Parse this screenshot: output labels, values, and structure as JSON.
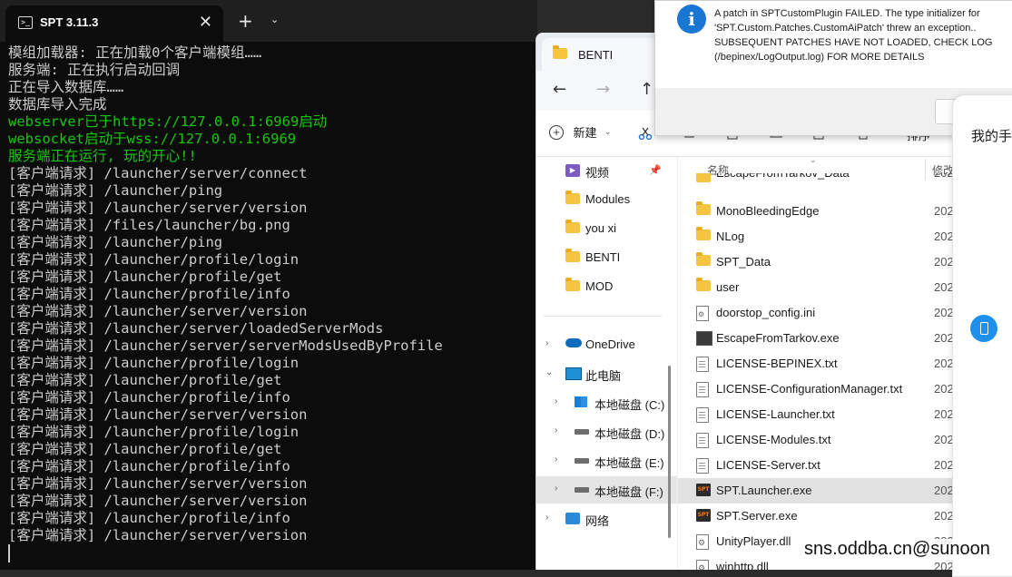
{
  "terminal": {
    "tab_title": "SPT 3.11.3",
    "tab_icon": ">_",
    "close_glyph": "✕",
    "new_tab_glyph": "+",
    "dropdown_glyph": "⌄",
    "lines": [
      {
        "text": "模组加载器: 正在加载0个客户端模组……",
        "color": "white"
      },
      {
        "text": "服务端: 正在执行启动回调",
        "color": "white"
      },
      {
        "text": "正在导入数据库……",
        "color": "white"
      },
      {
        "text": "数据库导入完成",
        "color": "white"
      },
      {
        "text": "webserver已于https://127.0.0.1:6969启动",
        "color": "green"
      },
      {
        "text": "websocket启动于wss://127.0.0.1:6969",
        "color": "green"
      },
      {
        "text": "服务端正在运行, 玩的开心!!",
        "color": "green"
      },
      {
        "text": "[客户端请求] /launcher/server/connect",
        "color": "white"
      },
      {
        "text": "[客户端请求] /launcher/ping",
        "color": "white"
      },
      {
        "text": "[客户端请求] /launcher/server/version",
        "color": "white"
      },
      {
        "text": "[客户端请求] /files/launcher/bg.png",
        "color": "white"
      },
      {
        "text": "[客户端请求] /launcher/ping",
        "color": "white"
      },
      {
        "text": "[客户端请求] /launcher/profile/login",
        "color": "white"
      },
      {
        "text": "[客户端请求] /launcher/profile/get",
        "color": "white"
      },
      {
        "text": "[客户端请求] /launcher/profile/info",
        "color": "white"
      },
      {
        "text": "[客户端请求] /launcher/server/version",
        "color": "white"
      },
      {
        "text": "[客户端请求] /launcher/server/loadedServerMods",
        "color": "white"
      },
      {
        "text": "[客户端请求] /launcher/server/serverModsUsedByProfile",
        "color": "white"
      },
      {
        "text": "[客户端请求] /launcher/profile/login",
        "color": "white"
      },
      {
        "text": "[客户端请求] /launcher/profile/get",
        "color": "white"
      },
      {
        "text": "[客户端请求] /launcher/profile/info",
        "color": "white"
      },
      {
        "text": "[客户端请求] /launcher/server/version",
        "color": "white"
      },
      {
        "text": "[客户端请求] /launcher/profile/login",
        "color": "white"
      },
      {
        "text": "[客户端请求] /launcher/profile/get",
        "color": "white"
      },
      {
        "text": "[客户端请求] /launcher/profile/info",
        "color": "white"
      },
      {
        "text": "[客户端请求] /launcher/server/version",
        "color": "white"
      },
      {
        "text": "[客户端请求] /launcher/server/version",
        "color": "white"
      },
      {
        "text": "[客户端请求] /launcher/profile/info",
        "color": "white"
      },
      {
        "text": "[客户端请求] /launcher/server/version",
        "color": "white"
      }
    ],
    "colors": {
      "white": "#cccccc",
      "green": "#16c60c",
      "background": "#0c0c0c"
    }
  },
  "explorer": {
    "tab_title": "BENTI",
    "nav": {
      "back": "←",
      "forward": "→",
      "up": "↑"
    },
    "toolbar": {
      "new_label": "新建",
      "new_chevron": "⌄",
      "sort_label": "排序"
    },
    "nav_pane": [
      {
        "label": "视频",
        "icon": "video-icon",
        "pinned": true
      },
      {
        "label": "Modules",
        "icon": "folder-icon"
      },
      {
        "label": "you xi",
        "icon": "folder-icon"
      },
      {
        "label": "BENTI",
        "icon": "folder-icon"
      },
      {
        "label": "MOD",
        "icon": "folder-icon"
      },
      {
        "label": "OneDrive",
        "icon": "onedrive-icon",
        "chevron": "›"
      },
      {
        "label": "此电脑",
        "icon": "pc-icon",
        "chevron": "⌄"
      },
      {
        "label": "本地磁盘 (C:)",
        "icon": "windows-drive-icon",
        "chevron": "›"
      },
      {
        "label": "本地磁盘 (D:)",
        "icon": "drive-icon",
        "chevron": "›"
      },
      {
        "label": "本地磁盘 (E:)",
        "icon": "drive-icon",
        "chevron": "›"
      },
      {
        "label": "本地磁盘 (F:)",
        "icon": "drive-icon",
        "chevron": "›",
        "selected": true
      },
      {
        "label": "网络",
        "icon": "network-icon",
        "chevron": "›"
      }
    ],
    "columns": {
      "name": "名称",
      "date": "修改"
    },
    "files": [
      {
        "name": "EscapeFromTarkov_Data",
        "icon": "folder-icon",
        "date": "202"
      },
      {
        "name": "MonoBleedingEdge",
        "icon": "folder-icon",
        "date": "202"
      },
      {
        "name": "NLog",
        "icon": "folder-icon",
        "date": "202"
      },
      {
        "name": "SPT_Data",
        "icon": "folder-icon",
        "date": "202"
      },
      {
        "name": "user",
        "icon": "folder-icon",
        "date": "202"
      },
      {
        "name": "doorstop_config.ini",
        "icon": "config-file-icon",
        "date": "202"
      },
      {
        "name": "EscapeFromTarkov.exe",
        "icon": "tarkov-exe-icon",
        "date": "202"
      },
      {
        "name": "LICENSE-BEPINEX.txt",
        "icon": "text-file-icon",
        "date": "202"
      },
      {
        "name": "LICENSE-ConfigurationManager.txt",
        "icon": "text-file-icon",
        "date": "202"
      },
      {
        "name": "LICENSE-Launcher.txt",
        "icon": "text-file-icon",
        "date": "202"
      },
      {
        "name": "LICENSE-Modules.txt",
        "icon": "text-file-icon",
        "date": "202"
      },
      {
        "name": "LICENSE-Server.txt",
        "icon": "text-file-icon",
        "date": "202"
      },
      {
        "name": "SPT.Launcher.exe",
        "icon": "spt-exe-icon",
        "date": "202",
        "selected": true
      },
      {
        "name": "SPT.Server.exe",
        "icon": "spt-exe-icon",
        "date": "202"
      },
      {
        "name": "UnityPlayer.dll",
        "icon": "dll-file-icon",
        "date": "202"
      },
      {
        "name": "winhttp.dll",
        "icon": "dll-file-icon",
        "date": "202"
      }
    ]
  },
  "dialog": {
    "icon": "i",
    "message_lines": [
      "A patch in SPTCustomPlugin FAILED. The type initializer for",
      "'SPT.Custom.Patches.CustomAiPatch' threw an exception..",
      "SUBSEQUENT PATCHES HAVE NOT LOADED, CHECK LOG",
      "(/bepinex/LogOutput.log) FOR MORE DETAILS"
    ]
  },
  "side_panel": {
    "title": "我的手"
  },
  "watermark": "sns.oddba.cn@sunoon"
}
